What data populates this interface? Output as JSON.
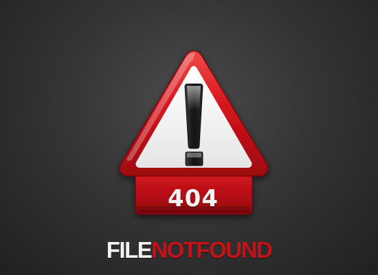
{
  "error": {
    "code": "404",
    "message_part1": "FILE",
    "message_part2": "NOTFOUND"
  },
  "icon": "warning-exclamation-icon",
  "colors": {
    "accent_red": "#c4121a",
    "background": "#333333",
    "text_light": "#f2f2f2"
  }
}
